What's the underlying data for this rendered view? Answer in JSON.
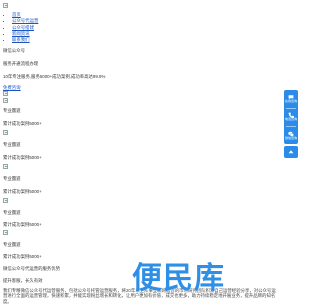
{
  "nav": {
    "items": [
      {
        "label": "首页"
      },
      {
        "label": "公众号代运营"
      },
      {
        "label": "公众号搭建"
      },
      {
        "label": "新闻资讯"
      },
      {
        "label": "联系我们"
      }
    ]
  },
  "hero": {
    "title": "微信公众号",
    "subtitle": "服务开通流程办理",
    "stats": "10年专注服务,服务5000+成功案例,成功率高达99.9%",
    "consult_link": "免费咨询"
  },
  "services": [
    {
      "name": "专业團遊",
      "desc": "累计成功案例5000+"
    },
    {
      "name": "专业團遊",
      "desc": "累计成功案例5000+"
    },
    {
      "name": "专业團遊",
      "desc": "累计成功案例5000+"
    },
    {
      "name": "专业團遊",
      "desc": "累计成功案例5000+"
    },
    {
      "name": "专业團遊",
      "desc": "累计成功案例5000+"
    }
  ],
  "footer": {
    "line1": "微信公众号代运营的服务优势",
    "line2": "提升客服，长久有效",
    "paragraph": "我们专精微信公众号代运营服务，包括公众号托管运营服务，将20年以上从事互联网运营的市场研究团队积累自己运营经验分享，对公众号运营进行全面的运营管理，快速积累，并能实现粉丝增长和转化，让用户更加有价值，成交也更多，助力持续稳定地开展业务，提升品牌的知名度。"
  },
  "float": {
    "items": [
      {
        "label": "在线咨询",
        "icon": "chat-icon"
      },
      {
        "label": "电话咨询",
        "icon": "phone-icon"
      },
      {
        "label": "微信咨询",
        "icon": "wechat-icon"
      }
    ],
    "top_icon": "arrow-up-icon"
  },
  "watermark": {
    "text": "便民库"
  },
  "colors": {
    "link": "#1a55c5",
    "accent": "#2a8ce8",
    "watermark": "#2f8fe6"
  }
}
